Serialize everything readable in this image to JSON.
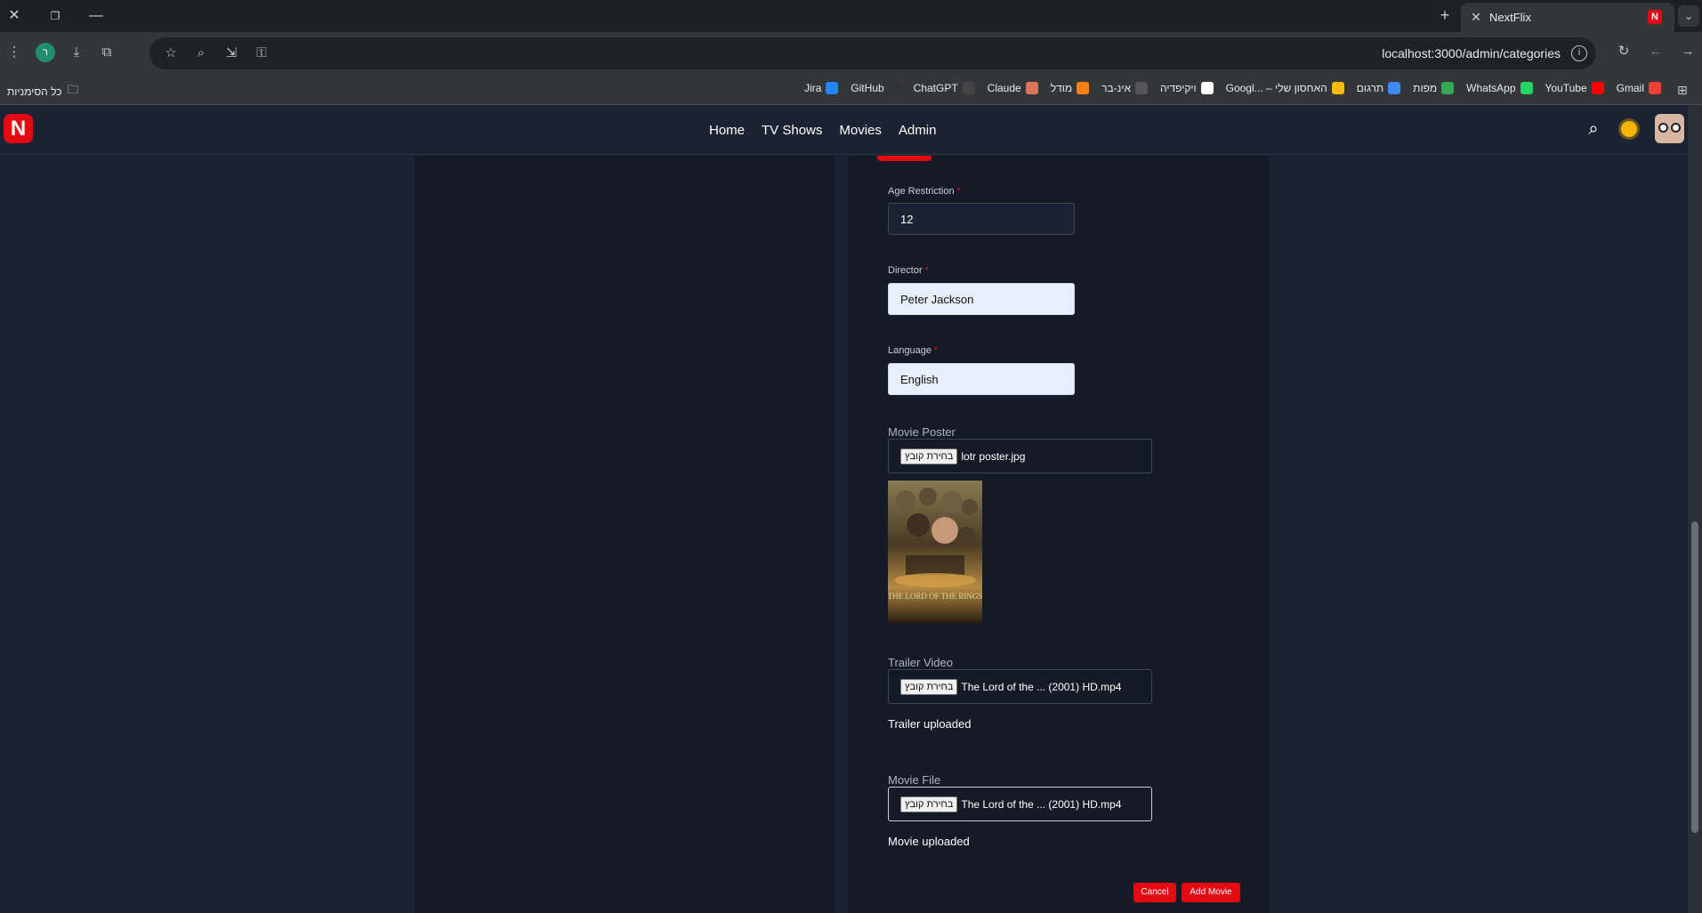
{
  "browser": {
    "tab_title": "NextFlix",
    "url": "localhost:3000/admin/categories",
    "profile_initial": "ר",
    "bookmarks_left": "כל הסימניות",
    "bookmarks": [
      {
        "label": "Jira",
        "icon": "jira-icon",
        "color": "#2684ff"
      },
      {
        "label": "GitHub",
        "icon": "github-icon",
        "color": "#333333"
      },
      {
        "label": "ChatGPT",
        "icon": "chatgpt-icon",
        "color": "#444444"
      },
      {
        "label": "Claude",
        "icon": "claude-icon",
        "color": "#d97757"
      },
      {
        "label": "מודל",
        "icon": "moodle-icon",
        "color": "#f98012"
      },
      {
        "label": "אינ-בר",
        "icon": "globe-icon",
        "color": "#555555"
      },
      {
        "label": "ויקיפדיה",
        "icon": "wikipedia-icon",
        "color": "#ffffff"
      },
      {
        "label": "Googl... – האחסון שלי",
        "icon": "drive-icon",
        "color": "#fbbc04"
      },
      {
        "label": "תרגום",
        "icon": "translate-icon",
        "color": "#4285f4"
      },
      {
        "label": "מפות",
        "icon": "maps-icon",
        "color": "#34a853"
      },
      {
        "label": "WhatsApp",
        "icon": "whatsapp-icon",
        "color": "#25d366"
      },
      {
        "label": "YouTube",
        "icon": "youtube-icon",
        "color": "#ff0000"
      },
      {
        "label": "Gmail",
        "icon": "gmail-icon",
        "color": "#ea4335"
      }
    ]
  },
  "app": {
    "logo_letter": "N",
    "brand_color": "#e50914",
    "nav": [
      "Home",
      "TV Shows",
      "Movies",
      "Admin"
    ]
  },
  "form": {
    "age_restriction": {
      "label": "Age Restriction",
      "required": "*",
      "value": "12"
    },
    "director": {
      "label": "Director",
      "required": "*",
      "value": "Peter Jackson"
    },
    "language": {
      "label": "Language",
      "required": "*",
      "value": "English"
    },
    "movie_poster": {
      "label": "Movie Poster",
      "button": "בחירת קובץ",
      "file": "lotr poster.jpg"
    },
    "poster_image": {
      "title_text": "THE LORD OF THE RINGS"
    },
    "trailer_video": {
      "label": "Trailer Video",
      "button": "בחירת קובץ",
      "file": "The Lord of the ... (2001) HD.mp4",
      "status": "Trailer uploaded"
    },
    "movie_file": {
      "label": "Movie File",
      "button": "בחירת קובץ",
      "file": "The Lord of the ... (2001) HD.mp4",
      "status": "Movie uploaded"
    },
    "cancel_label": "Cancel",
    "add_label": "Add Movie"
  }
}
